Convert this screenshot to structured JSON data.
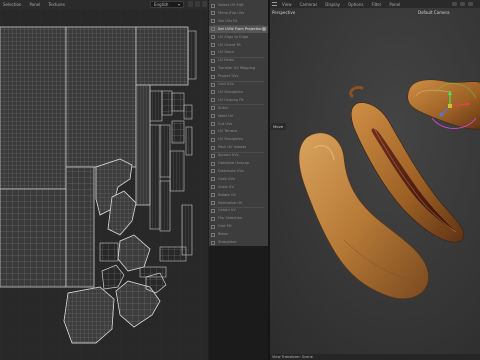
{
  "uv_editor": {
    "menu": [
      "Selection",
      "Panel",
      "Textures"
    ],
    "channel_select": "English"
  },
  "operators": {
    "rows": [
      {
        "label": "Select UV Edit",
        "highlight": false
      },
      {
        "label": "Mirror/Flip UVs",
        "highlight": false
      },
      {
        "label": "Set UVs Fit",
        "highlight": false
      },
      {
        "label": "Set UVW From Projection",
        "highlight": true
      },
      {
        "label": "UV Align to Edge",
        "highlight": false
      },
      {
        "label": "UV Orient Fit",
        "highlight": false
      },
      {
        "label": "UV Stack",
        "highlight": false
      },
      {
        "label": "UV Relax",
        "highlight": false
      },
      {
        "label": "Transfer UV Mapping",
        "highlight": false
      },
      {
        "label": "Project UVs",
        "highlight": false
      },
      {
        "label": "Grid UVs",
        "highlight": false
      },
      {
        "label": "UV Straighten",
        "highlight": false
      },
      {
        "label": "UV Unwrap Fit",
        "highlight": false
      },
      {
        "label": "Stitch",
        "highlight": false
      },
      {
        "label": "Weld UV",
        "highlight": false
      },
      {
        "label": "Cut UVs",
        "highlight": false
      },
      {
        "label": "UV Terrace",
        "highlight": false
      },
      {
        "label": "UV Straighten",
        "highlight": false
      },
      {
        "label": "Pack UV Islands",
        "highlight": false
      },
      {
        "label": "Spread UVs",
        "highlight": false
      },
      {
        "label": "Optimize Unwrap",
        "highlight": false
      },
      {
        "label": "Distribute UVs",
        "highlight": false
      },
      {
        "label": "Grab UVs",
        "highlight": false
      },
      {
        "label": "Scale UV",
        "highlight": false
      },
      {
        "label": "Rotate UV",
        "highlight": false
      },
      {
        "label": "Normalize UV",
        "highlight": false
      },
      {
        "label": "Unfold UV",
        "highlight": false
      },
      {
        "label": "Flip Selection",
        "highlight": false
      },
      {
        "label": "Grid Fill",
        "highlight": false
      },
      {
        "label": "Relax",
        "highlight": false
      },
      {
        "label": "Straighten",
        "highlight": false
      }
    ]
  },
  "viewport": {
    "menu": [
      "View",
      "Cameras",
      "Display",
      "Options",
      "Filter",
      "Panel"
    ],
    "view_label": "Perspective",
    "camera_label": "Default Camera",
    "tool_label": "Move",
    "status_text": "View Transform: Scene"
  }
}
